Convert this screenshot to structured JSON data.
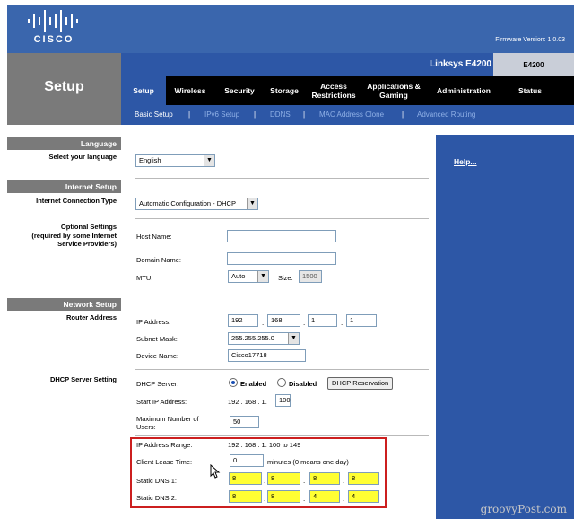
{
  "header": {
    "brand": "CISCO",
    "firmware": "Firmware Version: 1.0.03",
    "page_title": "Setup",
    "model_name": "Linksys E4200",
    "model_code": "E4200"
  },
  "tabs": [
    {
      "label": "Setup",
      "active": true
    },
    {
      "label": "Wireless"
    },
    {
      "label": "Security"
    },
    {
      "label": "Storage"
    },
    {
      "label": "Access Restrictions"
    },
    {
      "label": "Applications & Gaming"
    },
    {
      "label": "Administration"
    },
    {
      "label": "Status"
    }
  ],
  "subtabs": [
    {
      "label": "Basic Setup",
      "active": true
    },
    {
      "label": "IPv6 Setup"
    },
    {
      "label": "DDNS"
    },
    {
      "label": "MAC Address Clone"
    },
    {
      "label": "Advanced Routing"
    }
  ],
  "subtab_separator": "|",
  "sections": {
    "language": "Language",
    "internet_setup": "Internet Setup",
    "network_setup": "Network Setup"
  },
  "left_labels": {
    "select_language": "Select your language",
    "connection_type": "Internet Connection Type",
    "optional_settings": "Optional Settings",
    "optional_note": "(required by some Internet Service Providers)",
    "router_address": "Router Address",
    "dhcp_setting": "DHCP Server Setting"
  },
  "language": {
    "selected": "English"
  },
  "internet": {
    "connection_type": "Automatic Configuration - DHCP",
    "host_name_label": "Host Name:",
    "host_name_value": "",
    "domain_name_label": "Domain Name:",
    "domain_name_value": "",
    "mtu_label": "MTU:",
    "mtu_value": "Auto",
    "size_label": "Size:",
    "size_value": "1500"
  },
  "router": {
    "ip_label": "IP Address:",
    "ip": [
      "192",
      "168",
      "1",
      "1"
    ],
    "subnet_label": "Subnet Mask:",
    "subnet": "255.255.255.0",
    "device_label": "Device Name:",
    "device_name": "Cisco17718"
  },
  "dhcp": {
    "server_label": "DHCP Server:",
    "enabled_label": "Enabled",
    "disabled_label": "Disabled",
    "reservation_button": "DHCP Reservation",
    "start_ip_label": "Start IP Address:",
    "start_ip_prefix": "192 . 168 . 1.",
    "start_ip_value": "100",
    "max_users_label": "Maximum Number of Users:",
    "max_users_value": "50",
    "range_label": "IP Address Range:",
    "range_value": "192 . 168 . 1. 100 to 149",
    "lease_label": "Client Lease Time:",
    "lease_value": "0",
    "lease_note": "minutes (0 means one day)",
    "dns1_label": "Static DNS 1:",
    "dns1": [
      "8",
      "8",
      "8",
      "8"
    ],
    "dns2_label": "Static DNS 2:",
    "dns2": [
      "8",
      "8",
      "4",
      "4"
    ]
  },
  "help": {
    "link": "Help..."
  },
  "watermark": "groovyPost.com",
  "colors": {
    "header_blue": "#3a66ad",
    "nav_blue": "#2d57a6",
    "highlight": "#cc1f1f",
    "dns_fill": "#ffff33"
  }
}
